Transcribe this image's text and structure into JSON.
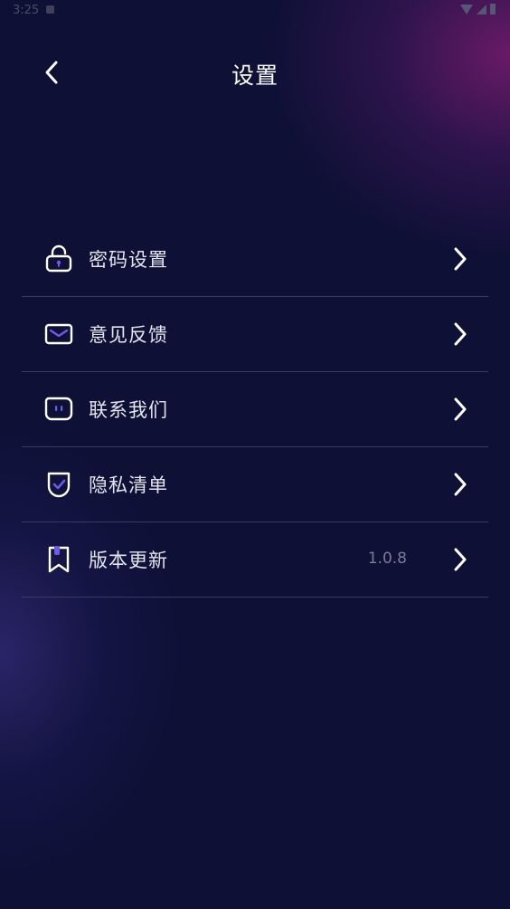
{
  "status_bar": {
    "time": "3:25"
  },
  "header": {
    "title": "设置",
    "back_icon": "chevron-left-icon"
  },
  "settings": {
    "items": [
      {
        "label": "密码设置",
        "icon": "lock-icon"
      },
      {
        "label": "意见反馈",
        "icon": "mail-icon"
      },
      {
        "label": "联系我们",
        "icon": "chat-icon"
      },
      {
        "label": "隐私清单",
        "icon": "shield-check-icon"
      },
      {
        "label": "版本更新",
        "icon": "bookmark-icon",
        "value": "1.0.8"
      }
    ]
  },
  "colors": {
    "background": "#0e1036",
    "accent_purple": "#6c5ce7",
    "divider": "#383a62"
  }
}
